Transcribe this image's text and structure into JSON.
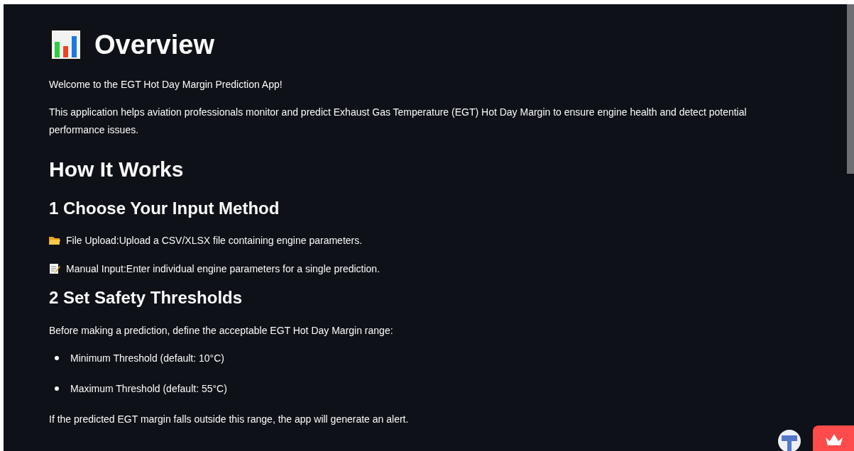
{
  "title": "Overview",
  "intro": [
    "Welcome to the EGT Hot Day Margin Prediction App!",
    "This application helps aviation professionals monitor and predict Exhaust Gas Temperature (EGT) Hot Day Margin to ensure engine health and detect potential performance issues."
  ],
  "heading": "How It Works",
  "sections": [
    {
      "heading": "1 Choose Your Input Method",
      "items": [
        {
          "kind": "folder",
          "text": "File Upload:Upload a CSV/XLSX file containing engine parameters."
        },
        {
          "kind": "memo",
          "text": "Manual Input:Enter individual engine parameters for a single prediction."
        }
      ]
    },
    {
      "heading": "2 Set Safety Thresholds",
      "items": [
        {
          "kind": "paragraph",
          "text": "Before making a prediction, define the acceptable EGT Hot Day Margin range:"
        },
        {
          "kind": "bullet",
          "text": "Minimum Threshold (default: 10°C)"
        },
        {
          "kind": "bullet",
          "text": "Maximum Threshold (default: 55°C)"
        },
        {
          "kind": "paragraph",
          "text": "If the predicted EGT margin falls outside this range, the app will generate an alert."
        }
      ]
    }
  ]
}
